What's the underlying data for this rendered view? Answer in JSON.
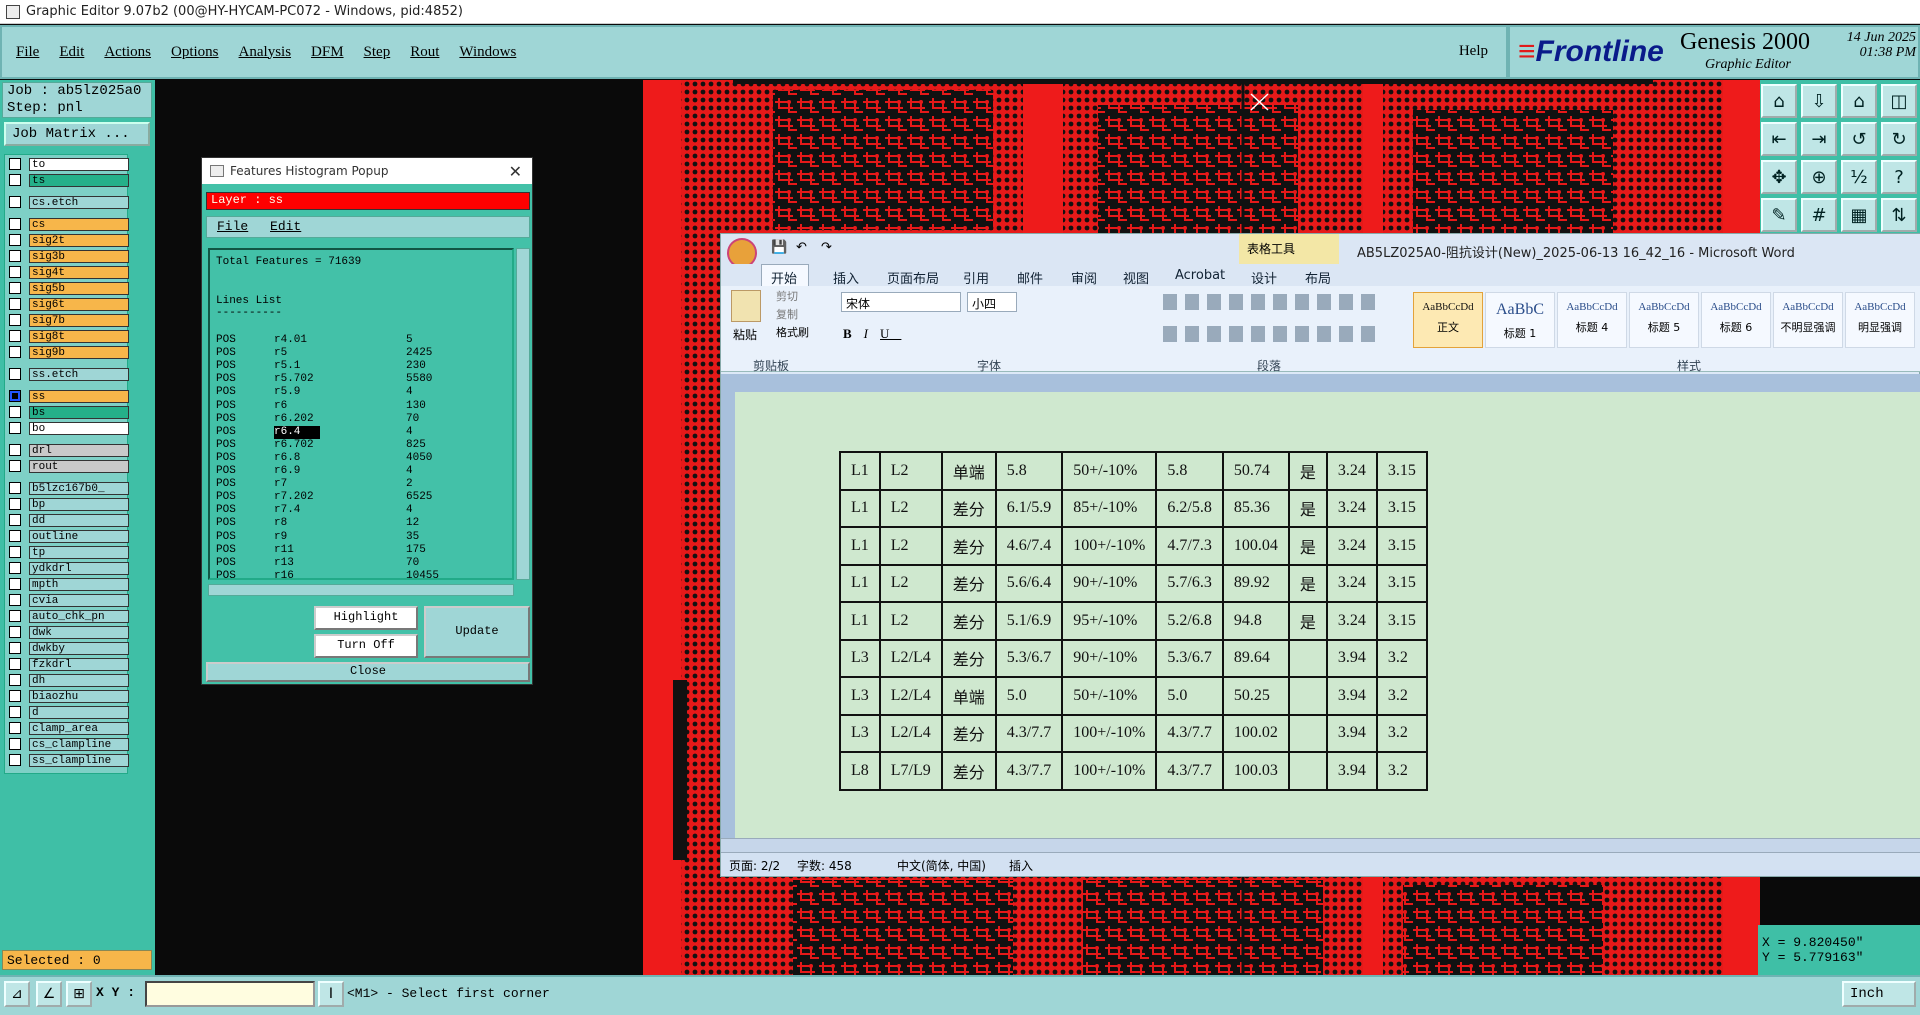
{
  "window": {
    "title": "Graphic Editor 9.07b2 (00@HY-HYCAM-PC072 - Windows, pid:4852)"
  },
  "menu": {
    "items": [
      "File",
      "Edit",
      "Actions",
      "Options",
      "Analysis",
      "DFM",
      "Step",
      "Rout",
      "Windows"
    ],
    "help": "Help"
  },
  "brand": {
    "logo_a": "≡",
    "logo_b": "Frontline",
    "product": "Genesis 2000",
    "sub": "Graphic Editor",
    "date": "14 Jun 2025",
    "time": "01:38 PM"
  },
  "job": {
    "job_label": "Job : ab5lz025a0",
    "step_label": "Step: pnl",
    "matrix_button": "Job Matrix ..."
  },
  "layers": [
    {
      "name": "to",
      "color": "#ffffff"
    },
    {
      "name": "ts",
      "color": "#25b089"
    },
    {
      "name": "cs.etch",
      "color": "#9fd6d6"
    },
    {
      "name": "cs",
      "color": "#f7b64a"
    },
    {
      "name": "sig2t",
      "color": "#f7b64a"
    },
    {
      "name": "sig3b",
      "color": "#f7b64a"
    },
    {
      "name": "sig4t",
      "color": "#f7b64a"
    },
    {
      "name": "sig5b",
      "color": "#f7b64a"
    },
    {
      "name": "sig6t",
      "color": "#f7b64a"
    },
    {
      "name": "sig7b",
      "color": "#f7b64a"
    },
    {
      "name": "sig8t",
      "color": "#f7b64a"
    },
    {
      "name": "sig9b",
      "color": "#f7b64a"
    },
    {
      "name": "ss.etch",
      "color": "#9fd6d6"
    },
    {
      "name": "ss",
      "color": "#f7b64a"
    },
    {
      "name": "bs",
      "color": "#25b089"
    },
    {
      "name": "bo",
      "color": "#ffffff"
    },
    {
      "name": "drl",
      "color": "#c9c9c9"
    },
    {
      "name": "rout",
      "color": "#c9c9c9"
    },
    {
      "name": "b5lzc167b0_",
      "color": "#9fd6d6"
    },
    {
      "name": "bp",
      "color": "#9fd6d6"
    },
    {
      "name": "dd",
      "color": "#9fd6d6"
    },
    {
      "name": "outline",
      "color": "#9fd6d6"
    },
    {
      "name": "tp",
      "color": "#9fd6d6"
    },
    {
      "name": "ydkdrl",
      "color": "#9fd6d6"
    },
    {
      "name": "mpth",
      "color": "#9fd6d6"
    },
    {
      "name": "cvia",
      "color": "#9fd6d6"
    },
    {
      "name": "auto_chk_pn",
      "color": "#9fd6d6"
    },
    {
      "name": "dwk",
      "color": "#9fd6d6"
    },
    {
      "name": "dwkby",
      "color": "#9fd6d6"
    },
    {
      "name": "fzkdrl",
      "color": "#9fd6d6"
    },
    {
      "name": "dh",
      "color": "#9fd6d6"
    },
    {
      "name": "biaozhu",
      "color": "#9fd6d6"
    },
    {
      "name": "d",
      "color": "#9fd6d6"
    },
    {
      "name": "clamp_area",
      "color": "#9fd6d6"
    },
    {
      "name": "cs_clampline",
      "color": "#9fd6d6"
    },
    {
      "name": "ss_clampline",
      "color": "#9fd6d6"
    }
  ],
  "selected": "Selected : 0",
  "popup": {
    "title": "Features Histogram Popup",
    "layer": "Layer :  ss",
    "menu": [
      "File",
      "Edit"
    ],
    "total": "Total Features = 71639",
    "list_title": "Lines List",
    "list_sep": "----------",
    "rows": [
      [
        "POS",
        "r4.01",
        "5"
      ],
      [
        "POS",
        "r5",
        "2425"
      ],
      [
        "POS",
        "r5.1",
        "230"
      ],
      [
        "POS",
        "r5.702",
        "5580"
      ],
      [
        "POS",
        "r5.9",
        "4"
      ],
      [
        "POS",
        "r6",
        "130"
      ],
      [
        "POS",
        "r6.202",
        "70"
      ],
      [
        "POS",
        "r6.4",
        "4"
      ],
      [
        "POS",
        "r6.702",
        "825"
      ],
      [
        "POS",
        "r6.8",
        "4050"
      ],
      [
        "POS",
        "r6.9",
        "4"
      ],
      [
        "POS",
        "r7",
        "2"
      ],
      [
        "POS",
        "r7.202",
        "6525"
      ],
      [
        "POS",
        "r7.4",
        "4"
      ],
      [
        "POS",
        "r8",
        "12"
      ],
      [
        "POS",
        "r9",
        "35"
      ],
      [
        "POS",
        "r11",
        "175"
      ],
      [
        "POS",
        "r13",
        "70"
      ],
      [
        "POS",
        "r16",
        "10455"
      ]
    ],
    "highlight": "Highlight",
    "turnoff": "Turn Off",
    "update": "Update",
    "close": "Close"
  },
  "word": {
    "context_tab": "表格工具",
    "title": "AB5LZ025A0-阻抗设计(New)_2025-06-13 16_42_16 - Microsoft Word",
    "tabs": [
      "开始",
      "插入",
      "页面布局",
      "引用",
      "邮件",
      "审阅",
      "视图",
      "Acrobat",
      "设计",
      "布局"
    ],
    "clipboard": {
      "paste": "粘贴",
      "cut": "剪切",
      "copy": "复制",
      "format": "格式刷"
    },
    "font": {
      "name": "宋体",
      "size": "小四"
    },
    "groups": [
      "剪贴板",
      "字体",
      "段落",
      "样式"
    ],
    "styles": [
      {
        "sample": "AaBbCcDd",
        "name": "正文"
      },
      {
        "sample": "AaBbC",
        "name": "标题 1"
      },
      {
        "sample": "AaBbCcDd",
        "name": "标题 4"
      },
      {
        "sample": "AaBbCcDd",
        "name": "标题 5"
      },
      {
        "sample": "AaBbCcDd",
        "name": "标题 6"
      },
      {
        "sample": "AaBbCcDd",
        "name": "不明显强调"
      },
      {
        "sample": "AaBbCcDd",
        "name": "明显强调"
      }
    ],
    "table": [
      [
        "L1",
        "L2",
        "单端",
        "5.8",
        "50+/-10%",
        "5.8",
        "50.74",
        "是",
        "3.24",
        "3.15"
      ],
      [
        "L1",
        "L2",
        "差分",
        "6.1/5.9",
        "85+/-10%",
        "6.2/5.8",
        "85.36",
        "是",
        "3.24",
        "3.15"
      ],
      [
        "L1",
        "L2",
        "差分",
        "4.6/7.4",
        "100+/-10%",
        "4.7/7.3",
        "100.04",
        "是",
        "3.24",
        "3.15"
      ],
      [
        "L1",
        "L2",
        "差分",
        "5.6/6.4",
        "90+/-10%",
        "5.7/6.3",
        "89.92",
        "是",
        "3.24",
        "3.15"
      ],
      [
        "L1",
        "L2",
        "差分",
        "5.1/6.9",
        "95+/-10%",
        "5.2/6.8",
        "94.8",
        "是",
        "3.24",
        "3.15"
      ],
      [
        "L3",
        "L2/L4",
        "差分",
        "5.3/6.7",
        "90+/-10%",
        "5.3/6.7",
        "89.64",
        "",
        "3.94",
        "3.2"
      ],
      [
        "L3",
        "L2/L4",
        "单端",
        "5.0",
        "50+/-10%",
        "5.0",
        "50.25",
        "",
        "3.94",
        "3.2"
      ],
      [
        "L3",
        "L2/L4",
        "差分",
        "4.3/7.7",
        "100+/-10%",
        "4.3/7.7",
        "100.02",
        "",
        "3.94",
        "3.2"
      ],
      [
        "L8",
        "L7/L9",
        "差分",
        "4.3/7.7",
        "100+/-10%",
        "4.3/7.7",
        "100.03",
        "",
        "3.94",
        "3.2"
      ]
    ],
    "status": {
      "page": "页面: 2/2",
      "words": "字数: 458",
      "lang": "中文(简体, 中国)",
      "mode": "插入"
    }
  },
  "coords": {
    "x": "X = 9.820450\"",
    "y": "Y = 5.779163\""
  },
  "bottom": {
    "xy_label": "X Y :",
    "prompt": "<M1> - Select first corner",
    "unit": "Inch"
  }
}
